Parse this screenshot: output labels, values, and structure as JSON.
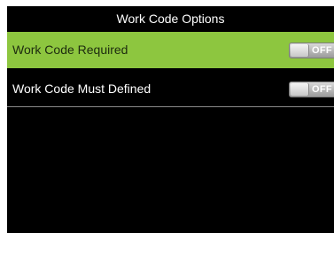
{
  "screen": {
    "title": "Work Code Options"
  },
  "options": [
    {
      "label": "Work Code Required",
      "toggle_state": "OFF",
      "highlighted": true
    },
    {
      "label": "Work Code Must Defined",
      "toggle_state": "OFF",
      "highlighted": false
    }
  ],
  "colors": {
    "highlight": "#8dc63f",
    "background": "#000000"
  },
  "icons": {
    "toggle": "toggle-switch-off-icon"
  }
}
